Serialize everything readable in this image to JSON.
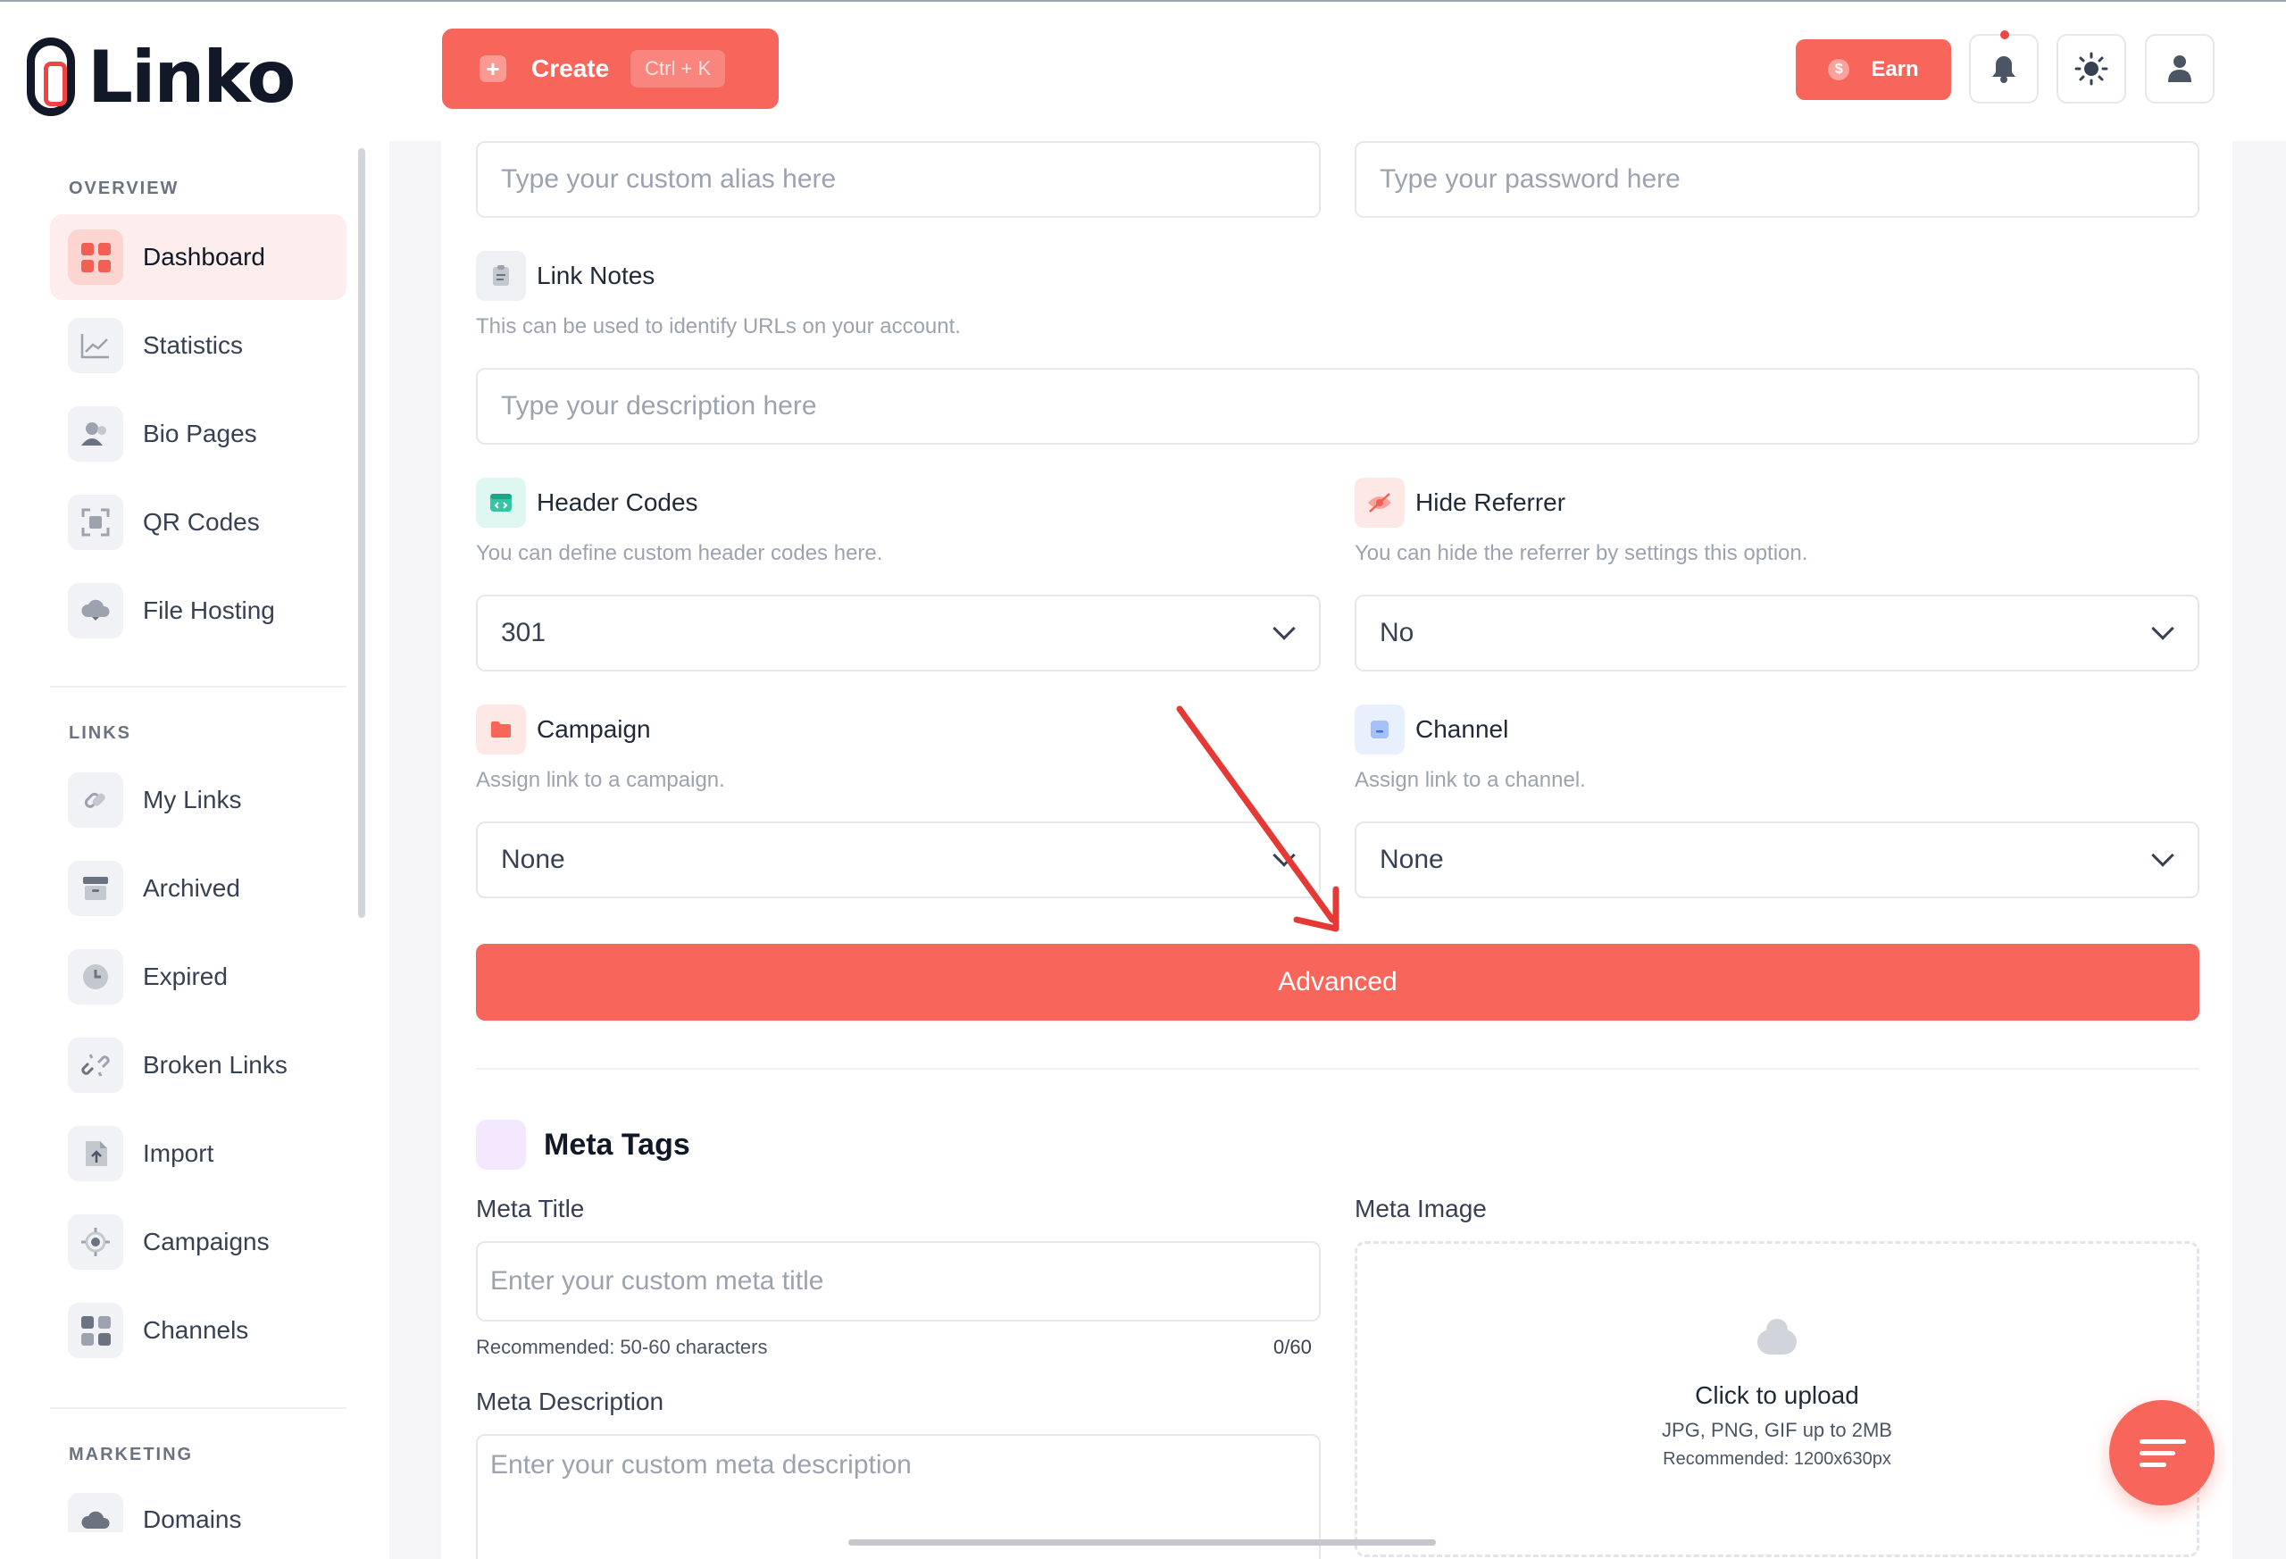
{
  "app": {
    "name": "Linko"
  },
  "sidebar": {
    "sections": [
      {
        "label": "OVERVIEW"
      },
      {
        "label": "LINKS"
      },
      {
        "label": "MARKETING"
      }
    ],
    "items": [
      {
        "label": "Dashboard",
        "icon": "dashboard-icon",
        "active": true
      },
      {
        "label": "Statistics",
        "icon": "chart-icon"
      },
      {
        "label": "Bio Pages",
        "icon": "users-icon"
      },
      {
        "label": "QR Codes",
        "icon": "qr-icon"
      },
      {
        "label": "File Hosting",
        "icon": "cloud-icon"
      },
      {
        "label": "My Links",
        "icon": "link-icon"
      },
      {
        "label": "Archived",
        "icon": "archive-icon"
      },
      {
        "label": "Expired",
        "icon": "clock-icon"
      },
      {
        "label": "Broken Links",
        "icon": "broken-link-icon"
      },
      {
        "label": "Import",
        "icon": "import-icon"
      },
      {
        "label": "Campaigns",
        "icon": "target-icon"
      },
      {
        "label": "Channels",
        "icon": "grid-icon"
      },
      {
        "label": "Domains",
        "icon": "cloud-icon"
      }
    ]
  },
  "topbar": {
    "create_label": "Create",
    "create_shortcut": "Ctrl + K",
    "earn_label": "Earn",
    "earn_coin": "$"
  },
  "form": {
    "alias_placeholder": "Type your custom alias here",
    "password_placeholder": "Type your password here",
    "link_notes": {
      "title": "Link Notes",
      "desc": "This can be used to identify URLs on your account.",
      "placeholder": "Type your description here"
    },
    "header_codes": {
      "title": "Header Codes",
      "desc": "You can define custom header codes here.",
      "value": "301"
    },
    "hide_referrer": {
      "title": "Hide Referrer",
      "desc": "You can hide the referrer by settings this option.",
      "value": "No"
    },
    "campaign": {
      "title": "Campaign",
      "desc": "Assign link to a campaign.",
      "value": "None"
    },
    "channel": {
      "title": "Channel",
      "desc": "Assign link to a channel.",
      "value": "None"
    },
    "advanced_label": "Advanced"
  },
  "meta": {
    "section_title": "Meta Tags",
    "title_label": "Meta Title",
    "title_placeholder": "Enter your custom meta title",
    "title_hint": "Recommended: 50-60 characters",
    "title_count": "0/60",
    "desc_label": "Meta Description",
    "desc_placeholder": "Enter your custom meta description",
    "image_label": "Meta Image",
    "upload_title": "Click to upload",
    "upload_formats": "JPG, PNG, GIF up to 2MB",
    "upload_recommended": "Recommended: 1200x630px"
  },
  "colors": {
    "accent": "#f8655a",
    "annotation_arrow": "#e53935"
  }
}
